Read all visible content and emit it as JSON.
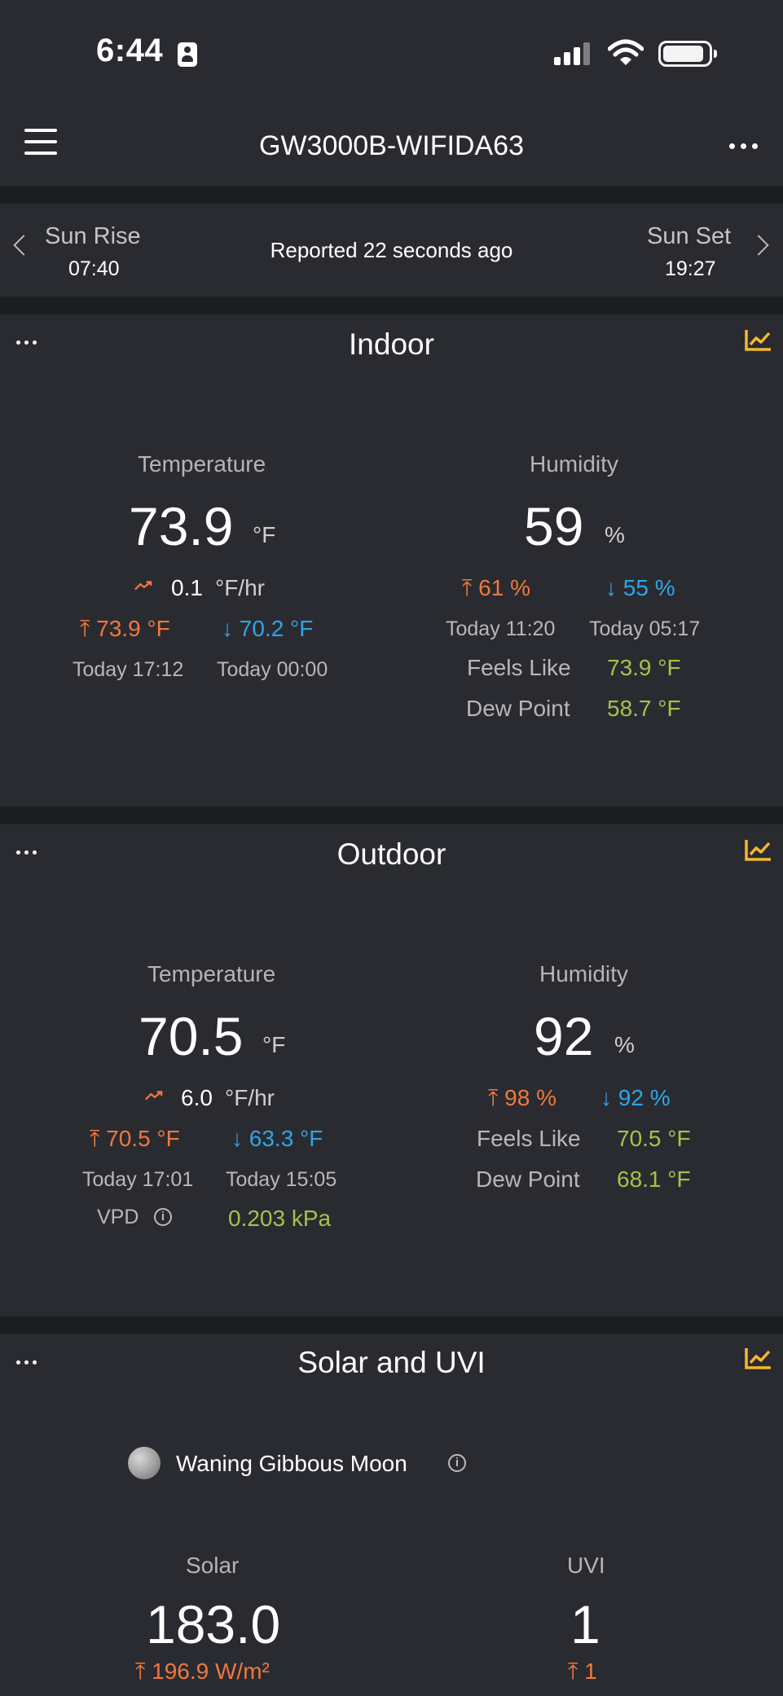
{
  "status_bar": {
    "time": "6:44"
  },
  "header": {
    "title": "GW3000B-WIFIDA63"
  },
  "sun": {
    "sunrise_label": "Sun Rise",
    "sunrise_time": "07:40",
    "reported": "Reported 22 seconds ago",
    "sunset_label": "Sun Set",
    "sunset_time": "19:27"
  },
  "indoor": {
    "title": "Indoor",
    "temp_label": "Temperature",
    "temp_value": "73.9",
    "temp_unit": "°F",
    "trend_value": "0.1",
    "trend_unit": "°F/hr",
    "temp_high": "⤒ 73.9 °F",
    "temp_low": "↓ 70.2 °F",
    "temp_high_time": "Today 17:12",
    "temp_low_time": "Today 00:00",
    "hum_label": "Humidity",
    "hum_value": "59",
    "hum_unit": "%",
    "hum_high": "⤒ 61 %",
    "hum_low": "↓ 55 %",
    "hum_high_time": "Today 11:20",
    "hum_low_time": "Today 05:17",
    "feels_like_label": "Feels Like",
    "feels_like_value": "73.9 °F",
    "dew_point_label": "Dew Point",
    "dew_point_value": "58.7 °F"
  },
  "outdoor": {
    "title": "Outdoor",
    "temp_label": "Temperature",
    "temp_value": "70.5",
    "temp_unit": "°F",
    "trend_value": "6.0",
    "trend_unit": "°F/hr",
    "temp_high": "⤒ 70.5 °F",
    "temp_low": "↓ 63.3 °F",
    "temp_high_time": "Today 17:01",
    "temp_low_time": "Today 15:05",
    "vpd_label": "VPD",
    "vpd_value": "0.203 kPa",
    "hum_label": "Humidity",
    "hum_value": "92",
    "hum_unit": "%",
    "hum_high": "⤒ 98 %",
    "hum_low": "↓ 92 %",
    "feels_like_label": "Feels Like",
    "feels_like_value": "70.5 °F",
    "dew_point_label": "Dew Point",
    "dew_point_value": "68.1 °F"
  },
  "solar": {
    "title": "Solar and UVI",
    "moon_phase": "Waning Gibbous Moon",
    "solar_label": "Solar",
    "solar_value": "183.0",
    "solar_high": "⤒ 196.9 W/m²",
    "uvi_label": "UVI",
    "uvi_value": "1",
    "uvi_high": "⤒ 1"
  },
  "colors": {
    "background": "#1c1d21",
    "card": "#2a2b31",
    "high": "#f0783c",
    "low": "#2fa5e6",
    "derived": "#a2c44a",
    "chart_icon": "#f5b82e"
  }
}
